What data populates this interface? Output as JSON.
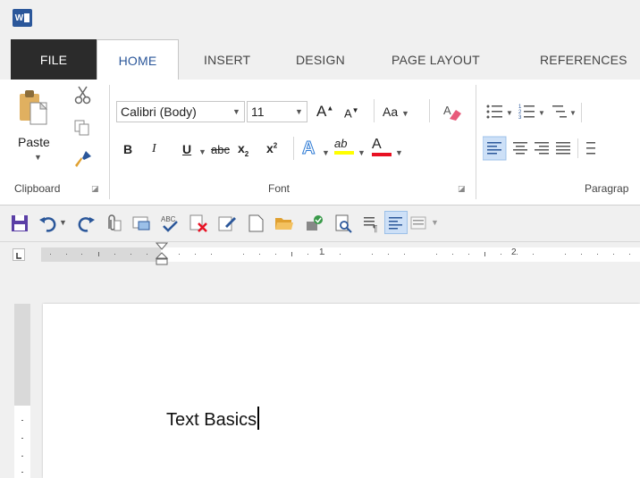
{
  "app": {
    "logo_text": "W"
  },
  "tabs": [
    {
      "label": "FILE"
    },
    {
      "label": "HOME"
    },
    {
      "label": "INSERT"
    },
    {
      "label": "DESIGN"
    },
    {
      "label": "PAGE LAYOUT"
    },
    {
      "label": "REFERENCES"
    }
  ],
  "clipboard": {
    "paste_label": "Paste",
    "group_label": "Clipboard"
  },
  "font": {
    "font_name": "Calibri (Body)",
    "font_size": "11",
    "grow_label": "A",
    "shrink_label": "A",
    "change_case_label": "Aa",
    "bold_label": "B",
    "italic_label": "I",
    "underline_label": "U",
    "strike_label": "abc",
    "subscript_label": "x",
    "subscript_mark": "2",
    "superscript_label": "x",
    "superscript_mark": "2",
    "text_effects_label": "A",
    "highlight_label": "ab",
    "font_color_label": "A",
    "group_label": "Font"
  },
  "paragraph": {
    "group_label": "Paragrap"
  },
  "ruler": {
    "mark_1": "1",
    "mark_2": "2"
  },
  "document": {
    "text": "Text Basics"
  },
  "colors": {
    "word_blue": "#2b579a",
    "highlight_yellow": "#ffff00",
    "font_red": "#e81123"
  }
}
